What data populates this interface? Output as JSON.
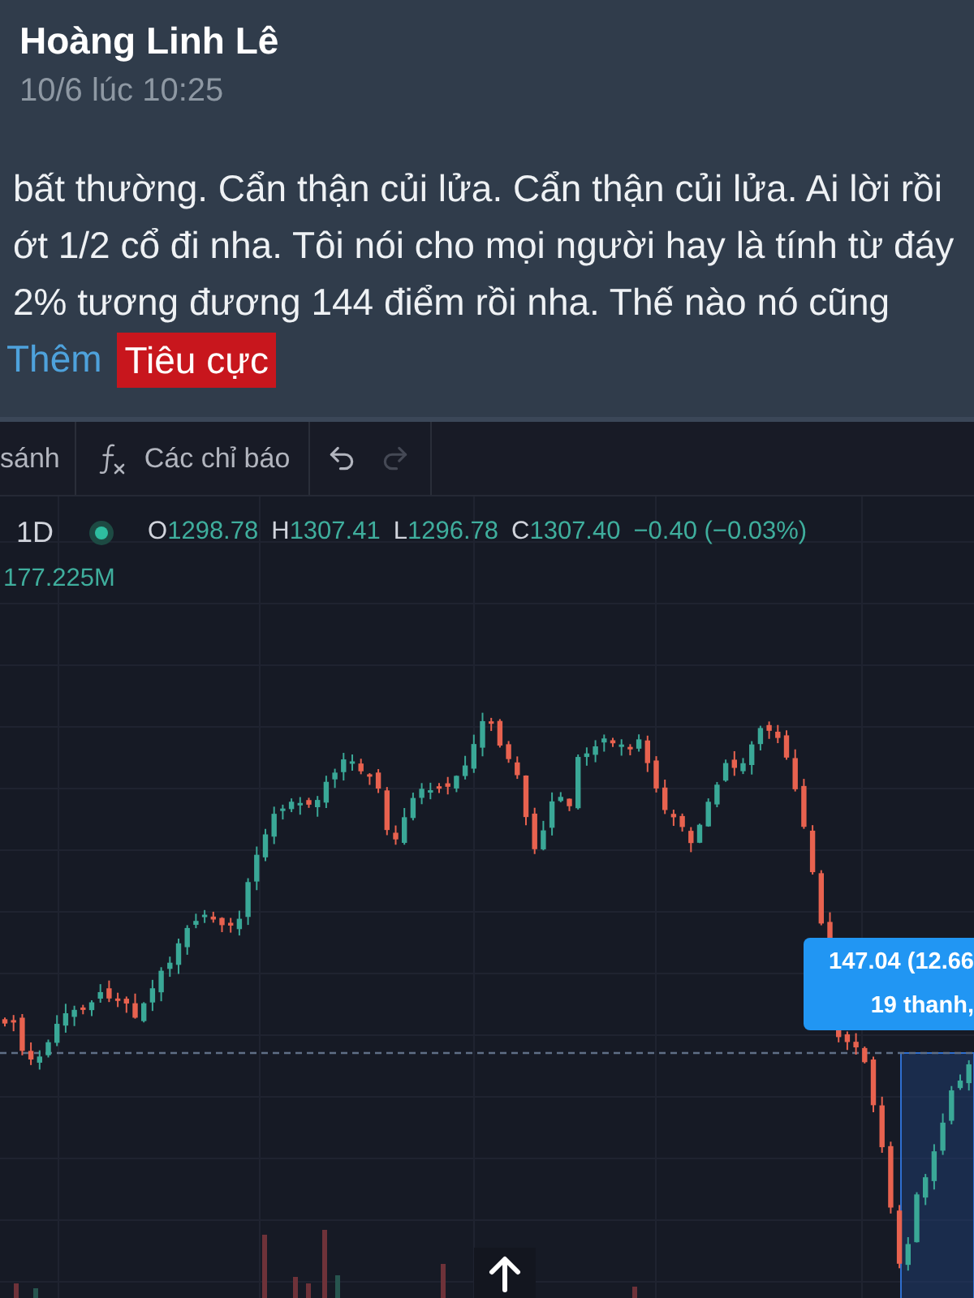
{
  "post": {
    "author": "Hoàng Linh Lê",
    "time": "10/6 lúc 10:25",
    "text_lines": [
      "bất thường. Cẩn thận củi lửa. Cẩn thận củi lửa. Ai lời rồi",
      "ớt 1/2 cổ đi nha. Tôi nói cho mọi người hay là tính từ đáy",
      "2% tương đương 144 điểm rồi nha. Thế nào nó cũng"
    ],
    "see_more": "Thêm",
    "sentiment_tag": "Tiêu cực"
  },
  "chart_toolbar": {
    "buttons": [
      {
        "kind": "text",
        "label": "sánh"
      },
      {
        "kind": "indicators",
        "label": "Các chỉ báo"
      },
      {
        "kind": "undo",
        "disabled": false
      },
      {
        "kind": "redo",
        "disabled": true
      }
    ]
  },
  "legend": {
    "interval": "1D",
    "ohlc": [
      {
        "label": "O",
        "value": "1298.78"
      },
      {
        "label": "H",
        "value": "1307.41"
      },
      {
        "label": "L",
        "value": "1296.78"
      },
      {
        "label": "C",
        "value": "1307.40"
      }
    ],
    "change": "−0.40 (−0.03%)",
    "volume": "177.225M"
  },
  "measure_tooltip": {
    "lines": [
      "147.04 (12.66",
      "19 thanh,"
    ]
  }
}
